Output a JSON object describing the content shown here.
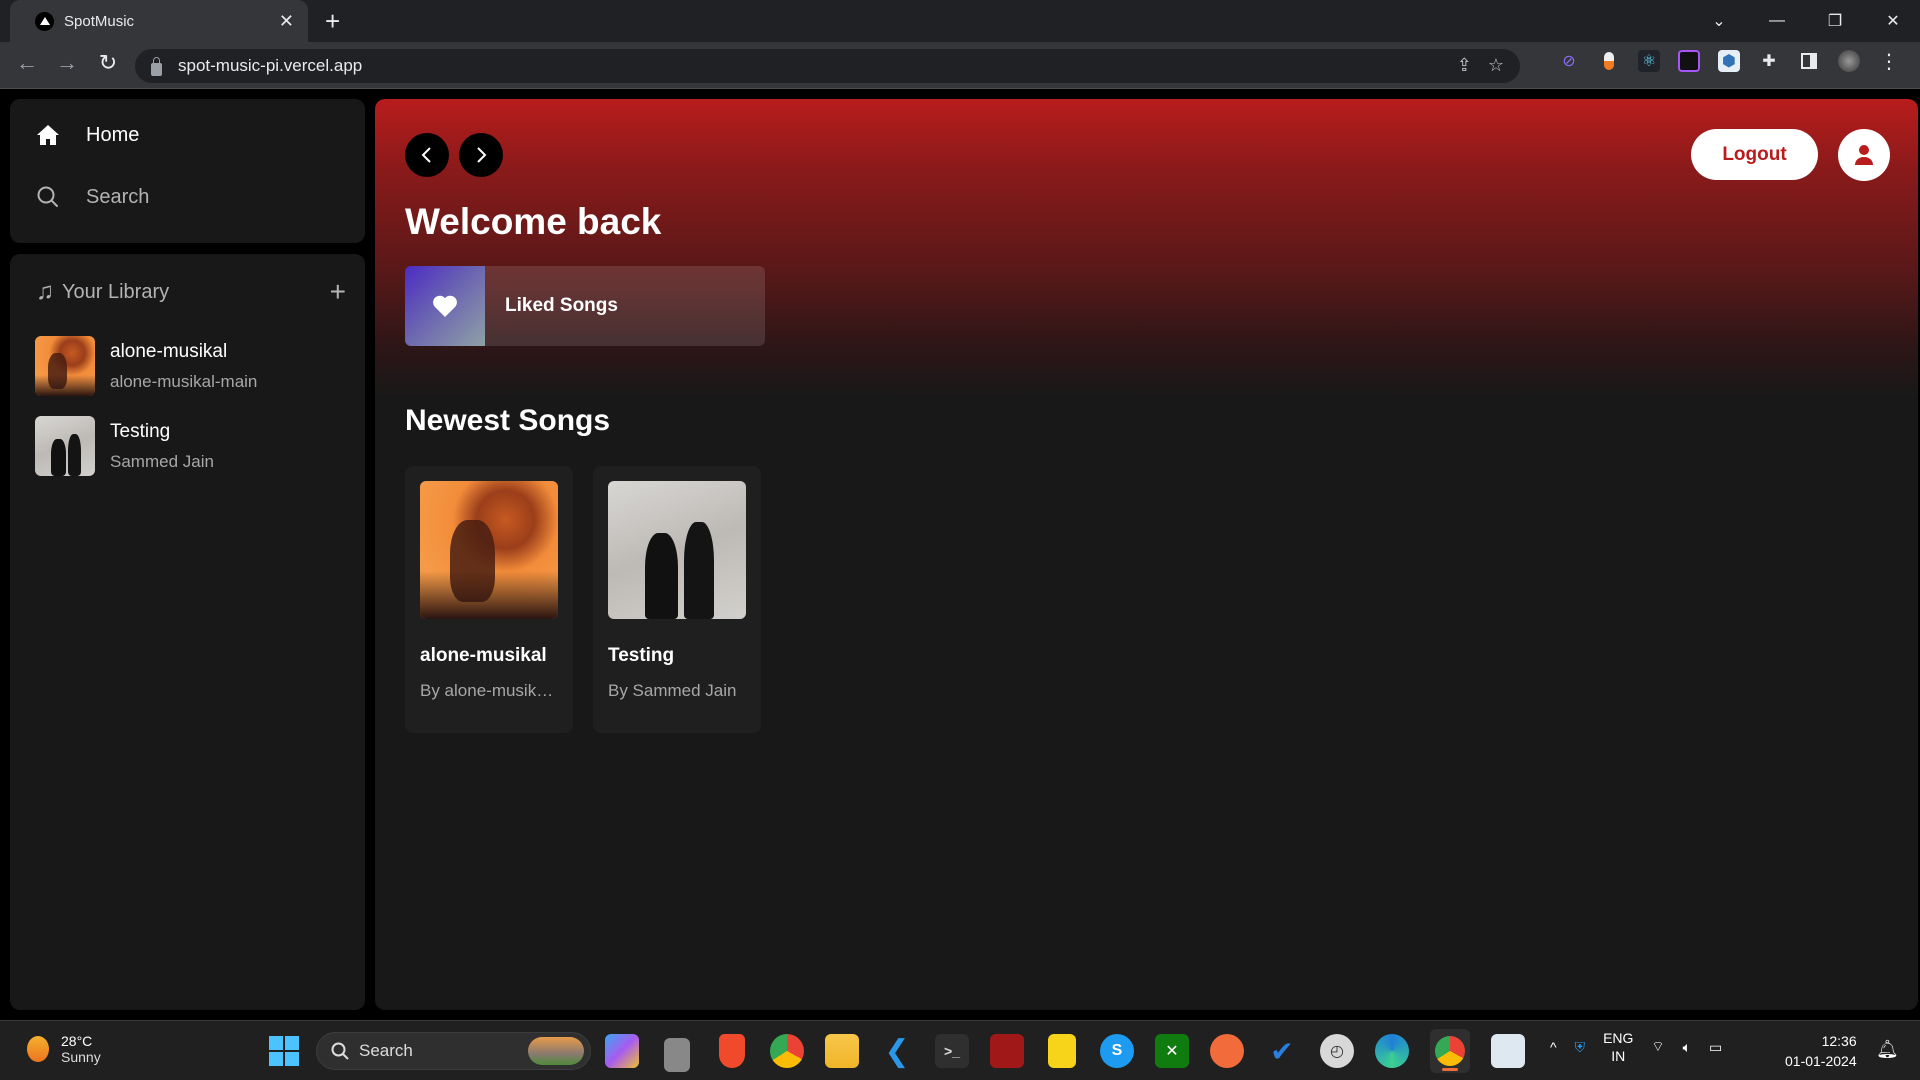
{
  "browser": {
    "tab_title": "SpotMusic",
    "tab_close": "✕",
    "new_tab": "+",
    "url": "spot-music-pi.vercel.app",
    "window_controls": [
      "⌄",
      "—",
      "❐",
      "✕"
    ],
    "nav": {
      "back": "←",
      "forward": "→",
      "reload": "↻"
    },
    "omnibox_icons": {
      "share": "⇪",
      "bookmark": "☆"
    },
    "extensions": [
      "paperclip",
      "capsule",
      "react",
      "color-picker",
      "cube",
      "puzzle",
      "sidepanel",
      "profile",
      "menu"
    ]
  },
  "sidebar": {
    "nav": [
      {
        "label": "Home",
        "icon": "home-icon"
      },
      {
        "label": "Search",
        "icon": "search-icon"
      }
    ],
    "library": {
      "title": "Your Library",
      "add": "+",
      "items": [
        {
          "title": "alone-musikal",
          "subtitle": "alone-musikal-main",
          "cover": "orange"
        },
        {
          "title": "Testing",
          "subtitle": "Sammed Jain",
          "cover": "gray"
        }
      ]
    }
  },
  "main": {
    "accent": "#b91c1c",
    "logout_label": "Logout",
    "greeting": "Welcome back",
    "liked_songs": "Liked Songs",
    "section_title": "Newest Songs",
    "songs": [
      {
        "title": "alone-musikal",
        "author": "By alone-musikal-main",
        "cover": "orange"
      },
      {
        "title": "Testing",
        "author": "By Sammed Jain",
        "cover": "gray"
      }
    ]
  },
  "taskbar": {
    "weather_temp": "28°C",
    "weather_desc": "Sunny",
    "search_label": "Search",
    "apps": [
      "copilot",
      "task-view",
      "brave",
      "chrome",
      "file-explorer",
      "vscode",
      "terminal",
      "msi",
      "sticky-notes",
      "skype",
      "xbox",
      "postman",
      "todo",
      "clock",
      "edge",
      "chrome-active",
      "perf-monitor"
    ],
    "lang_1": "ENG",
    "lang_2": "IN",
    "time": "12:36",
    "date": "01-01-2024"
  }
}
